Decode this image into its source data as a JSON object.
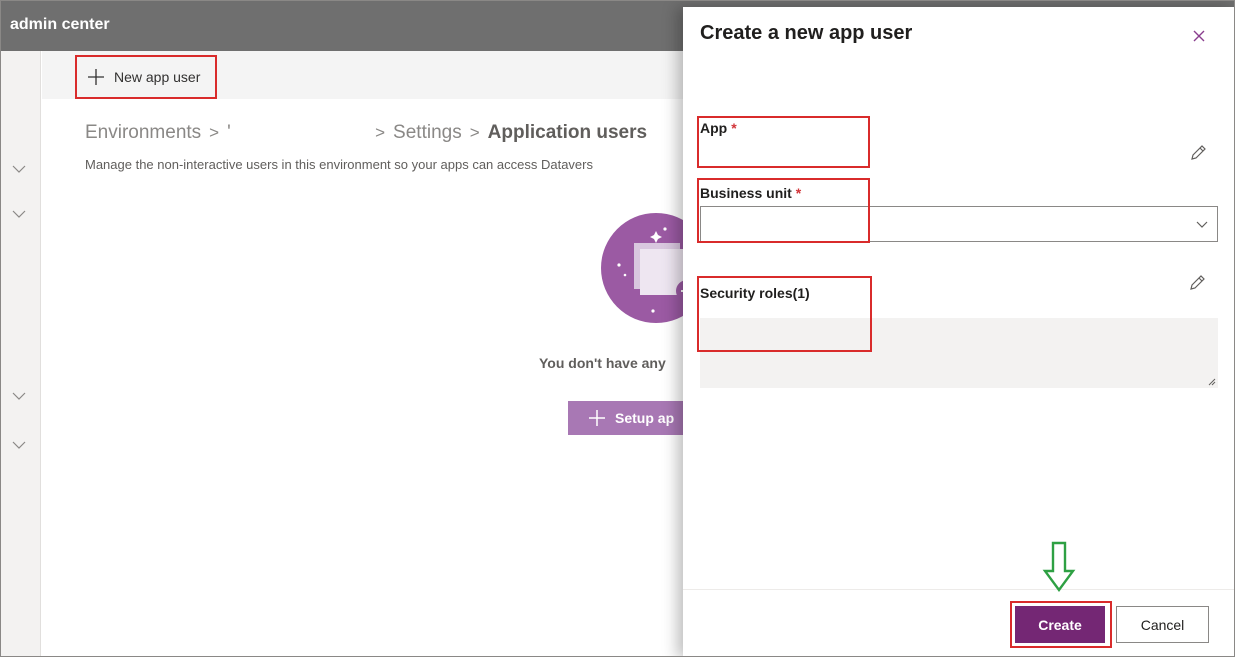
{
  "topbar": {
    "title": "admin center"
  },
  "commandbar": {
    "new_app_user_label": "New app user"
  },
  "breadcrumb": {
    "environments": "Environments",
    "settings": "Settings",
    "application_users": "Application users"
  },
  "page": {
    "description": "Manage the non-interactive users in this environment so your apps can access Datavers",
    "empty_text": "You don't have any",
    "setup_button_label": "Setup ap"
  },
  "panel": {
    "title": "Create a new app user",
    "fields": {
      "app_label": "App",
      "app_required": "*",
      "business_unit_label": "Business unit",
      "business_unit_required": "*",
      "business_unit_value": "",
      "security_roles_label": "Security roles(1)"
    },
    "create_label": "Create",
    "cancel_label": "Cancel"
  },
  "colors": {
    "brand_purple": "#742774",
    "highlight_red": "#d92b2b",
    "arrow_green": "#2ea043",
    "topbar_gray": "#6f6f6f"
  }
}
